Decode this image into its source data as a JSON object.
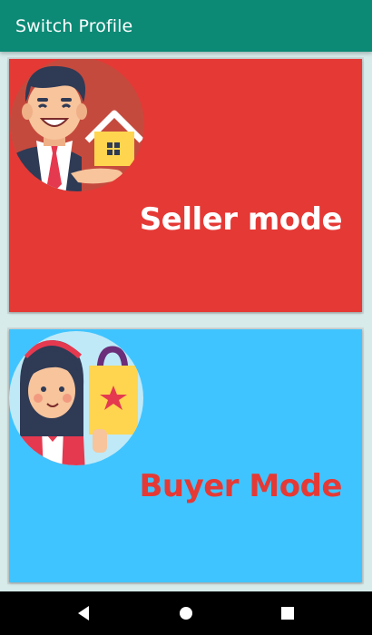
{
  "appbar": {
    "title": "Switch Profile"
  },
  "cards": [
    {
      "label": "Seller mode",
      "color": "#e53935",
      "label_color": "#ffffff",
      "icon": "seller-house-avatar-icon"
    },
    {
      "label": "Buyer Mode",
      "color": "#40c4ff",
      "label_color": "#e53935",
      "icon": "buyer-shopping-avatar-icon"
    }
  ],
  "navbar": {
    "icons": [
      "back-icon",
      "home-icon",
      "recents-icon"
    ]
  }
}
